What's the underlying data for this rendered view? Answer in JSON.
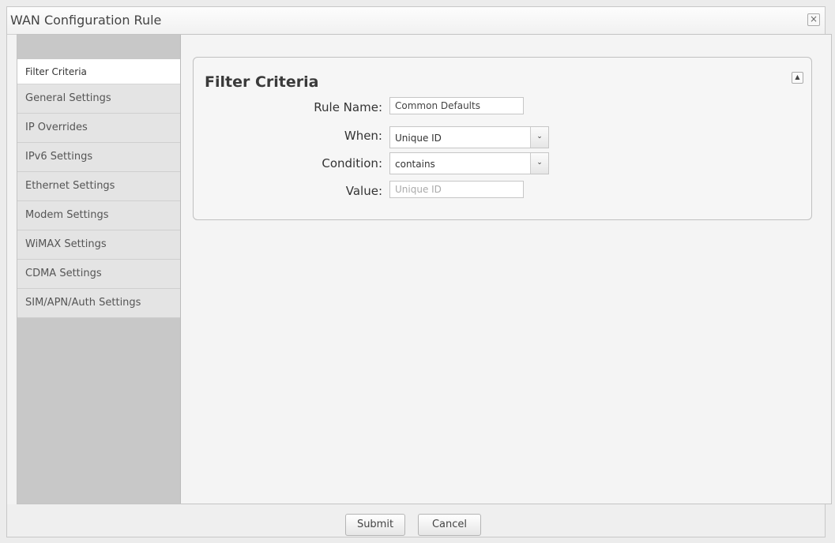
{
  "dialog": {
    "title": "WAN Configuration Rule",
    "close_symbol": "×"
  },
  "sidebar": {
    "items": [
      {
        "label": "Filter Criteria",
        "active": true
      },
      {
        "label": "General Settings"
      },
      {
        "label": "IP Overrides"
      },
      {
        "label": "IPv6 Settings"
      },
      {
        "label": "Ethernet Settings"
      },
      {
        "label": "Modem Settings"
      },
      {
        "label": "WiMAX Settings"
      },
      {
        "label": "CDMA Settings"
      },
      {
        "label": "SIM/APN/Auth Settings"
      }
    ]
  },
  "panel": {
    "title": "Filter Criteria",
    "collapse_symbol": "▲",
    "rule_name": {
      "label": "Rule Name:",
      "value": "Common Defaults"
    },
    "when": {
      "label": "When:",
      "value": "Unique ID",
      "arrow": "⌄"
    },
    "condition": {
      "label": "Condition:",
      "value": "contains",
      "arrow": "⌄"
    },
    "value_field": {
      "label": "Value:",
      "placeholder": "Unique ID"
    }
  },
  "footer": {
    "submit_label": "Submit",
    "cancel_label": "Cancel"
  }
}
